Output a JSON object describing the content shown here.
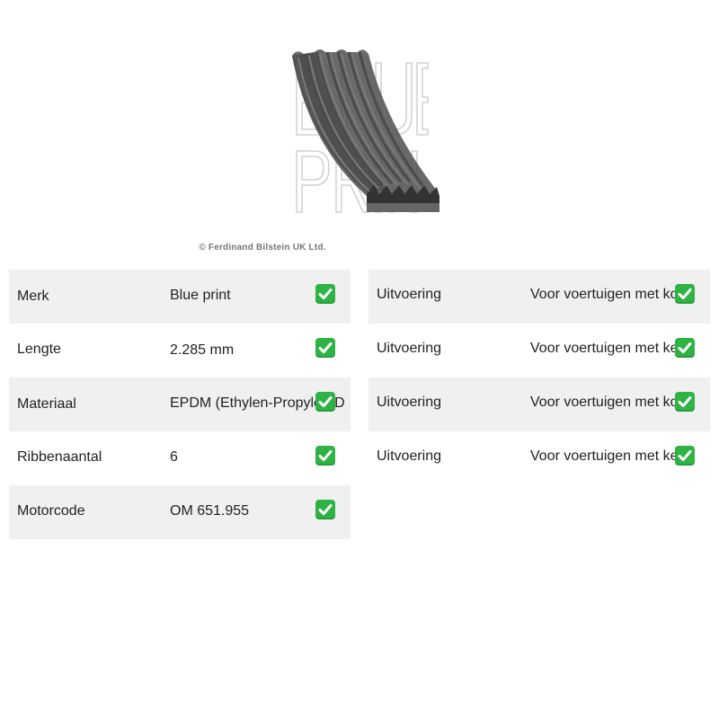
{
  "image": {
    "alt_icon": "v-ribbed-belt-image",
    "watermark_text": "BLUE PRINT"
  },
  "copyright": "© Ferdinand Bilstein UK Ltd.",
  "colors": {
    "shaded_row": "#f0f0f0",
    "check_green": "#2fb344",
    "belt_gray": "#5a5a5a"
  },
  "left_table": [
    {
      "label": "Merk",
      "value": "Blue print",
      "shaded": true
    },
    {
      "label": "Lengte",
      "value": "2.285 mm",
      "shaded": false
    },
    {
      "label": "Materiaal",
      "value": "EPDM (Ethylen-Propylen-D",
      "shaded": true
    },
    {
      "label": "Ribbenaantal",
      "value": "6",
      "shaded": false
    },
    {
      "label": "Motorcode",
      "value": "OM 651.955",
      "shaded": true
    }
  ],
  "right_table": [
    {
      "label": "Uitvoering",
      "value": "Voor voertuigen met kon",
      "shaded": true
    },
    {
      "label": "Uitvoering",
      "value": "Voor voertuigen met ker",
      "shaded": false
    },
    {
      "label": "Uitvoering",
      "value": "Voor voertuigen met kon",
      "shaded": true
    },
    {
      "label": "Uitvoering",
      "value": "Voor voertuigen met ker",
      "shaded": false
    }
  ]
}
